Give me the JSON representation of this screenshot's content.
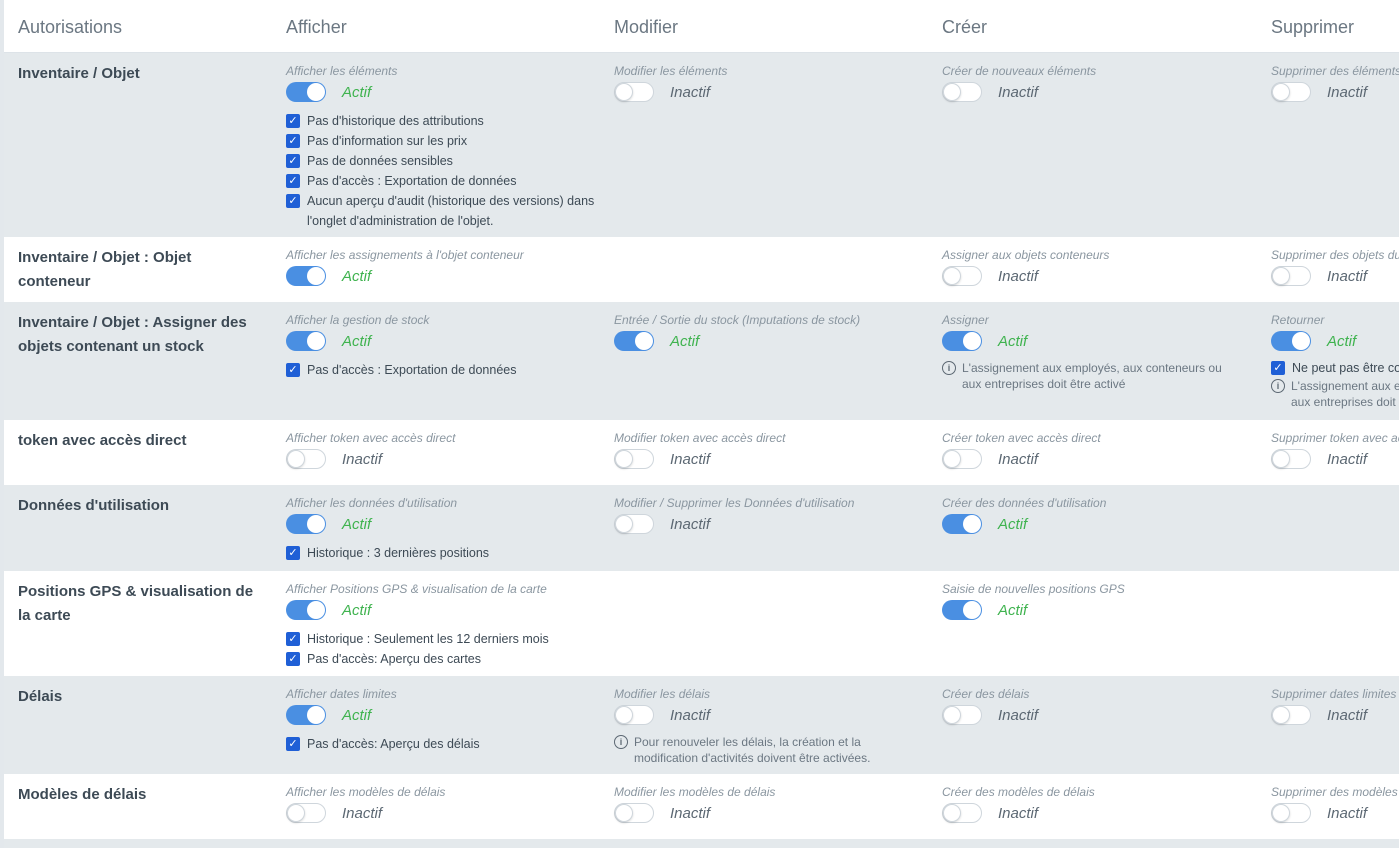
{
  "header": {
    "authorizations": "Autorisations",
    "view": "Afficher",
    "edit": "Modifier",
    "create": "Créer",
    "delete": "Supprimer"
  },
  "rows": [
    {
      "title": "Inventaire / Objet",
      "view": {
        "label": "Afficher les éléments",
        "status": "Actif",
        "checks": [
          "Pas d'historique des attributions",
          "Pas d'information sur les prix",
          "Pas de données sensibles",
          "Pas d'accès : Exportation de données",
          "Aucun aperçu d'audit (historique des versions) dans l'onglet d'administration de l'objet."
        ]
      },
      "edit": {
        "label": "Modifier les éléments",
        "status": "Inactif"
      },
      "create": {
        "label": "Créer de nouveaux éléments",
        "status": "Inactif"
      },
      "delete": {
        "label": "Supprimer des éléments",
        "status": "Inactif"
      }
    },
    {
      "title": "Inventaire / Objet : Objet conteneur",
      "view": {
        "label": "Afficher les assignements à l'objet conteneur",
        "status": "Actif"
      },
      "create": {
        "label": "Assigner aux objets conteneurs",
        "status": "Inactif"
      },
      "delete": {
        "label": "Supprimer des objets du",
        "status": "Inactif"
      }
    },
    {
      "title": "Inventaire / Objet : Assigner des objets contenant un stock",
      "view": {
        "label": "Afficher la gestion de stock",
        "status": "Actif",
        "checks": [
          "Pas d'accès : Exportation de données"
        ]
      },
      "edit": {
        "label": "Entrée / Sortie du stock (Imputations de stock)",
        "status": "Actif"
      },
      "create": {
        "label": "Assigner",
        "status": "Actif",
        "info": "L'assignement aux employés, aux conteneurs ou aux entreprises doit être activé"
      },
      "delete": {
        "label": "Retourner",
        "status": "Actif",
        "check": "Ne peut pas être con",
        "info_line1": "L'assignement aux e",
        "info_line2": "aux entreprises doit"
      }
    },
    {
      "title": "token avec accès direct",
      "view": {
        "label": "Afficher token avec accès direct",
        "status": "Inactif"
      },
      "edit": {
        "label": "Modifier token avec accès direct",
        "status": "Inactif"
      },
      "create": {
        "label": "Créer token avec accès direct",
        "status": "Inactif"
      },
      "delete": {
        "label": "Supprimer token avec acc",
        "status": "Inactif"
      }
    },
    {
      "title": "Données d'utilisation",
      "view": {
        "label": "Afficher les données d'utilisation",
        "status": "Actif",
        "checks": [
          "Historique : 3 dernières positions"
        ]
      },
      "edit": {
        "label": "Modifier / Supprimer les Données d'utilisation",
        "status": "Inactif"
      },
      "create": {
        "label": "Créer des données d'utilisation",
        "status": "Actif"
      }
    },
    {
      "title": "Positions GPS & visualisation de la carte",
      "view": {
        "label": "Afficher Positions GPS & visualisation de la carte",
        "status": "Actif",
        "checks": [
          "Historique : Seulement les 12 derniers mois",
          "Pas d'accès: Aperçu des cartes"
        ]
      },
      "create": {
        "label": "Saisie de nouvelles positions GPS",
        "status": "Actif"
      }
    },
    {
      "title": "Délais",
      "view": {
        "label": "Afficher dates limites",
        "status": "Actif",
        "checks": [
          "Pas d'accès: Aperçu des délais"
        ]
      },
      "edit": {
        "label": "Modifier les délais",
        "status": "Inactif",
        "info": "Pour renouveler les délais, la création et la modification d'activités doivent être activées."
      },
      "create": {
        "label": "Créer des délais",
        "status": "Inactif"
      },
      "delete": {
        "label": "Supprimer dates limites",
        "status": "Inactif"
      }
    },
    {
      "title": "Modèles de délais",
      "view": {
        "label": "Afficher les modèles de délais",
        "status": "Inactif"
      },
      "edit": {
        "label": "Modifier les modèles de délais",
        "status": "Inactif"
      },
      "create": {
        "label": "Créer des modèles de délais",
        "status": "Inactif"
      },
      "delete": {
        "label": "Supprimer des modèles d",
        "status": "Inactif"
      }
    }
  ],
  "colors": {
    "accent": "#4a8fe2",
    "active_text": "#3fb34f",
    "checkbox": "#1f5fd6",
    "row_shaded": "#e4e9ec"
  },
  "icons": {
    "check": "check-icon",
    "info": "info-icon"
  }
}
